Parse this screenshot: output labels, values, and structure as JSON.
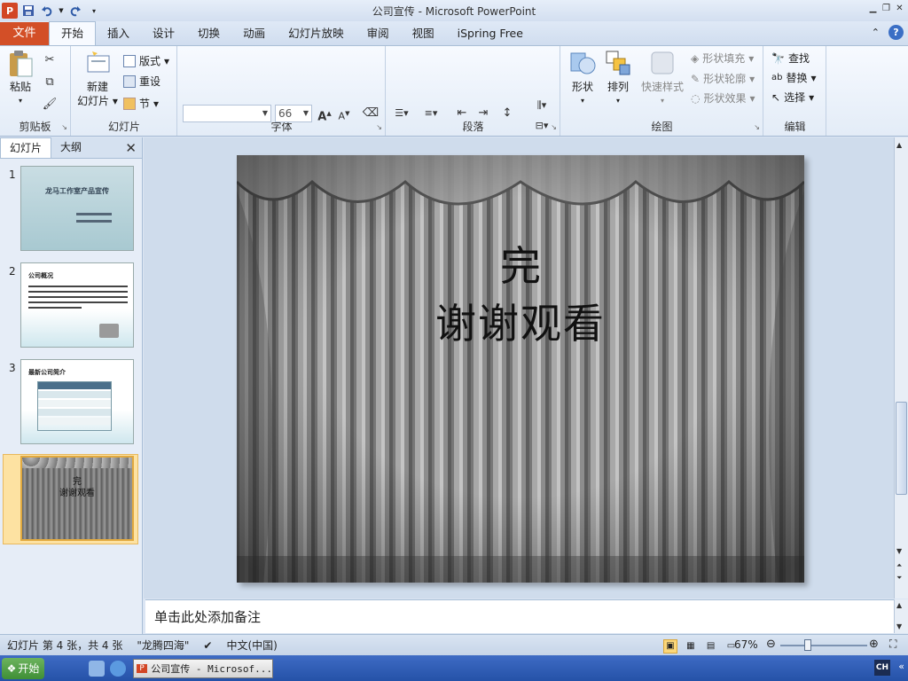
{
  "window": {
    "title": "公司宣传 - Microsoft PowerPoint"
  },
  "ribbon_tabs": {
    "file": "文件",
    "tabs": [
      "开始",
      "插入",
      "设计",
      "切换",
      "动画",
      "幻灯片放映",
      "审阅",
      "视图",
      "iSpring Free"
    ]
  },
  "ribbon": {
    "clipboard": {
      "paste": "粘贴",
      "label": "剪贴板"
    },
    "slides": {
      "new_slide_1": "新建",
      "new_slide_2": "幻灯片",
      "layout": "版式",
      "reset": "重设",
      "section": "节",
      "label": "幻灯片"
    },
    "font": {
      "font_name": "",
      "font_size": "66",
      "label": "字体"
    },
    "paragraph": {
      "label": "段落"
    },
    "drawing": {
      "shapes": "形状",
      "arrange": "排列",
      "quick_styles": "快速样式",
      "shape_fill": "形状填充",
      "shape_outline": "形状轮廓",
      "shape_effects": "形状效果",
      "label": "绘图"
    },
    "editing": {
      "find": "查找",
      "replace": "替换",
      "select": "选择",
      "label": "编辑"
    }
  },
  "panel": {
    "tab_slides": "幻灯片",
    "tab_outline": "大纲",
    "thumbs": [
      {
        "num": "1",
        "title": "龙马工作室产品宣传"
      },
      {
        "num": "2",
        "title": "公司概况"
      },
      {
        "num": "3",
        "title": "最新公司简介"
      },
      {
        "num": "4",
        "line1": "完",
        "line2": "谢谢观看"
      }
    ]
  },
  "slide": {
    "line1": "完",
    "line2": "谢谢观看"
  },
  "notes": {
    "placeholder": "单击此处添加备注"
  },
  "status": {
    "slide_info": "幻灯片 第 4 张，共 4 张",
    "theme": "\"龙腾四海\"",
    "language": "中文(中国)",
    "zoom": "67%",
    "zoom_value": 67
  },
  "taskbar": {
    "start": "开始",
    "task": "公司宣传 - Microsof...",
    "ime": "CH"
  },
  "colors": {
    "file_tab": "#d34f27",
    "selected_thumb": "#e1a93f",
    "taskbar": "#2552a8"
  }
}
